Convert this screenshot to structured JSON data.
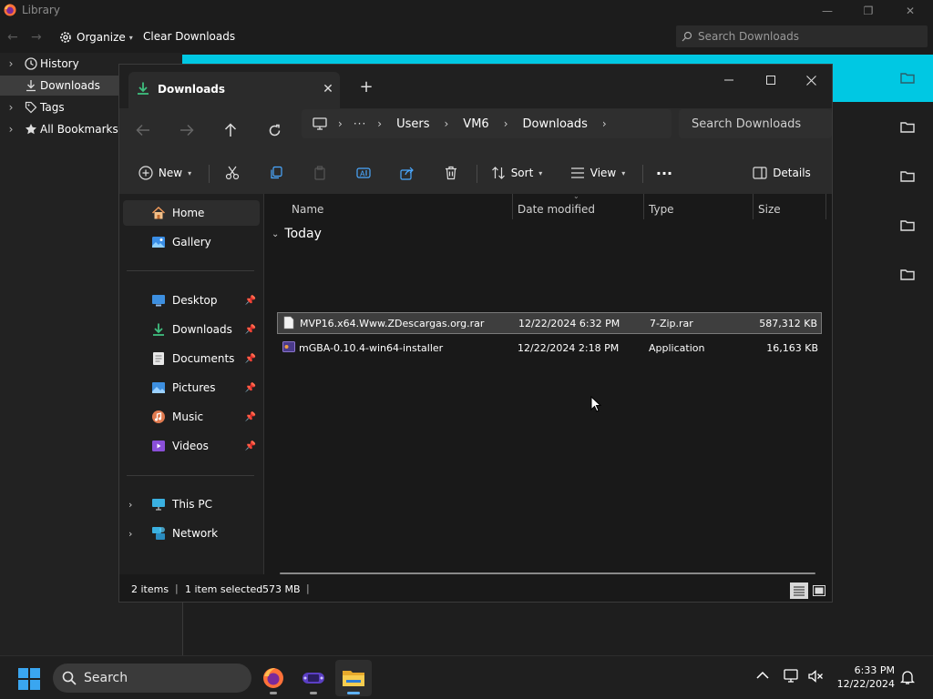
{
  "library": {
    "title": "Library",
    "organize_label": "Organize",
    "clear_label": "Clear Downloads",
    "search_placeholder": "Search Downloads",
    "sidebar": [
      {
        "label": "History",
        "icon": "clock-icon"
      },
      {
        "label": "Downloads",
        "icon": "download-icon",
        "selected": true
      },
      {
        "label": "Tags",
        "icon": "tag-icon"
      },
      {
        "label": "All Bookmarks",
        "icon": "star-icon"
      }
    ]
  },
  "explorer": {
    "tab_title": "Downloads",
    "breadcrumb": [
      "Users",
      "VM6",
      "Downloads"
    ],
    "search_placeholder": "Search Downloads",
    "commands": {
      "new_label": "New",
      "sort_label": "Sort",
      "view_label": "View",
      "details_label": "Details"
    },
    "nav": {
      "home": "Home",
      "gallery": "Gallery",
      "desktop": "Desktop",
      "downloads": "Downloads",
      "documents": "Documents",
      "pictures": "Pictures",
      "music": "Music",
      "videos": "Videos",
      "this_pc": "This PC",
      "network": "Network"
    },
    "columns": {
      "name": "Name",
      "date_modified": "Date modified",
      "type": "Type",
      "size": "Size"
    },
    "group_label": "Today",
    "files": [
      {
        "name": "MVP16.x64.Www.ZDescargas.org.rar",
        "date": "12/22/2024 6:32 PM",
        "type": "7-Zip.rar",
        "size": "587,312 KB",
        "selected": true
      },
      {
        "name": "mGBA-0.10.4-win64-installer",
        "date": "12/22/2024 2:18 PM",
        "type": "Application",
        "size": "16,163 KB",
        "selected": false
      }
    ],
    "status": {
      "items": "2 items",
      "selection": "1 item selected",
      "size": "573 MB"
    }
  },
  "taskbar": {
    "search_label": "Search",
    "time": "6:33 PM",
    "date": "12/22/2024"
  },
  "colors": {
    "accent_cyan": "#00c8e3",
    "folder_yellow": "#f2c14e",
    "download_green": "#3fbf7f"
  }
}
